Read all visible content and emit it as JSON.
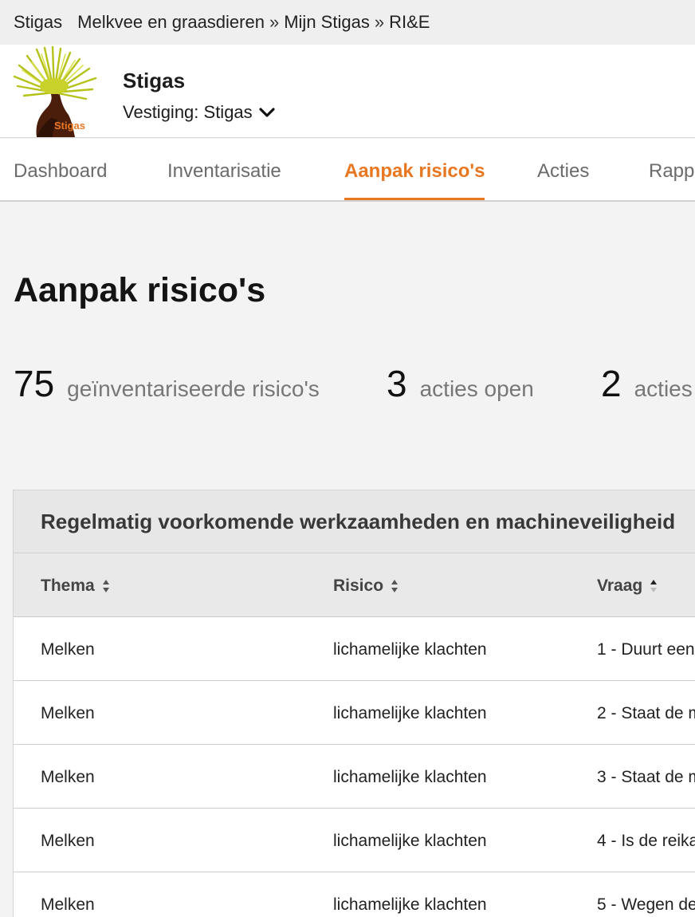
{
  "topbar": {
    "brand": "Stigas",
    "breadcrumb": [
      "Melkvee en graasdieren",
      "Mijn Stigas",
      "RI&E"
    ],
    "separator": "»"
  },
  "header": {
    "logo_text": "Stigas",
    "org_name": "Stigas",
    "vestiging_label": "Vestiging: Stigas"
  },
  "tabs": [
    {
      "label": "Dashboard",
      "active": false
    },
    {
      "label": "Inventarisatie",
      "active": false
    },
    {
      "label": "Aanpak risico's",
      "active": true
    },
    {
      "label": "Acties",
      "active": false
    },
    {
      "label": "Rapp",
      "active": false
    }
  ],
  "page_title": "Aanpak risico's",
  "stats": [
    {
      "value": "75",
      "label": "geïnventariseerde risico's"
    },
    {
      "value": "3",
      "label": "acties open"
    },
    {
      "value": "2",
      "label": "acties"
    }
  ],
  "table": {
    "title": "Regelmatig voorkomende werkzaamheden en machineveiligheid",
    "columns": [
      {
        "label": "Thema",
        "sort": "none"
      },
      {
        "label": "Risico",
        "sort": "none"
      },
      {
        "label": "Vraag",
        "sort": "asc"
      }
    ],
    "rows": [
      {
        "thema": "Melken",
        "risico": "lichamelijke klachten",
        "vraag": "1 - Duurt een"
      },
      {
        "thema": "Melken",
        "risico": "lichamelijke klachten",
        "vraag": "2 - Staat de m"
      },
      {
        "thema": "Melken",
        "risico": "lichamelijke klachten",
        "vraag": "3 - Staat de m"
      },
      {
        "thema": "Melken",
        "risico": "lichamelijke klachten",
        "vraag": "4 - Is de reika"
      },
      {
        "thema": "Melken",
        "risico": "lichamelijke klachten",
        "vraag": "5 - Wegen de"
      }
    ]
  },
  "colors": {
    "accent": "#e87722",
    "logo_green": "#b8c41a",
    "logo_brown": "#5a2a10"
  }
}
